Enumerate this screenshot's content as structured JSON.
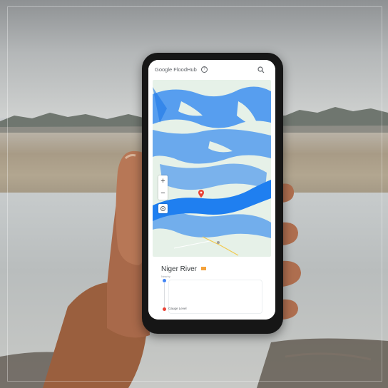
{
  "app": {
    "logo_text": "Google FloodHub",
    "help_symbol": "?",
    "search_icon": "search-icon"
  },
  "map": {
    "zoom_in": "+",
    "zoom_out": "−",
    "locate_icon": "crosshair-icon",
    "pin_icon": "map-pin-icon",
    "flood_color": "#2e86f0",
    "land_color": "#e6f1e8"
  },
  "panel": {
    "title": "Niger River",
    "subtitle": "Nearby",
    "gauge_label": "Gauge Level",
    "flag_color": "#f4a23b"
  }
}
